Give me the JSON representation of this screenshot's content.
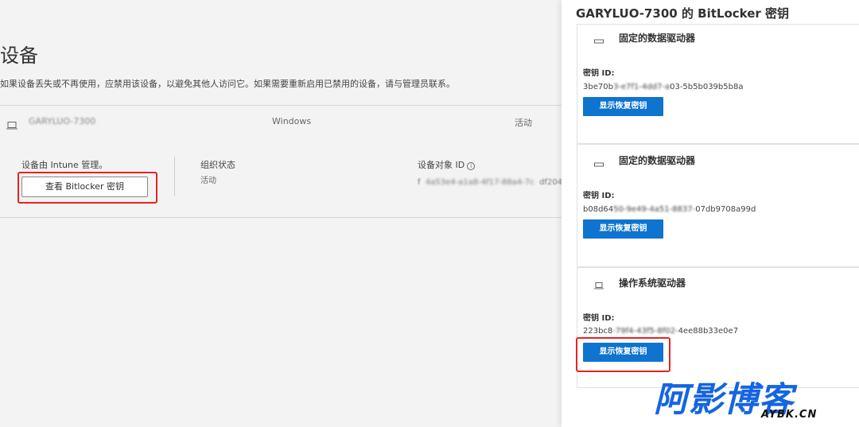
{
  "page": {
    "title": "设备",
    "description": "如果设备丢失或不再使用，应禁用该设备，以避免其他人访问它。如果需要重新启用已禁用的设备，请与管理员联系。"
  },
  "device": {
    "name": "GARYLUO-7300",
    "os": "Windows",
    "status": "活动",
    "managed_label": "设备由 Intune 管理。",
    "bitlocker_button": "查看 Bitlocker 密钥",
    "org_state_label": "组织状态",
    "org_state_value": "活动",
    "object_id_label": "设备对象 ID",
    "object_id_value_start": "f",
    "object_id_value_end": "df204"
  },
  "panel": {
    "title": "GARYLUO-7300 的 BitLocker 密钥",
    "key_label": "密钥 ID:",
    "show_button": "显示恢复密钥",
    "drives": [
      {
        "name": "固定的数据驱动器",
        "icon": "drive-icon",
        "key_start": "3be70b",
        "key_end": "03-5b5b039b5b8a"
      },
      {
        "name": "固定的数据驱动器",
        "icon": "drive-icon",
        "key_start": "b08d64",
        "key_end": "07db9708a99d"
      },
      {
        "name": "操作系统驱动器",
        "icon": "laptop-icon",
        "key_start": "223bc8",
        "key_end": "4ee88b33e0e7"
      }
    ]
  },
  "watermark": {
    "cn": "阿影博客",
    "en": "AYBK.CN"
  },
  "colors": {
    "accent": "#0e74d0",
    "highlight": "#e8231f",
    "watermark": "#1565e0"
  }
}
